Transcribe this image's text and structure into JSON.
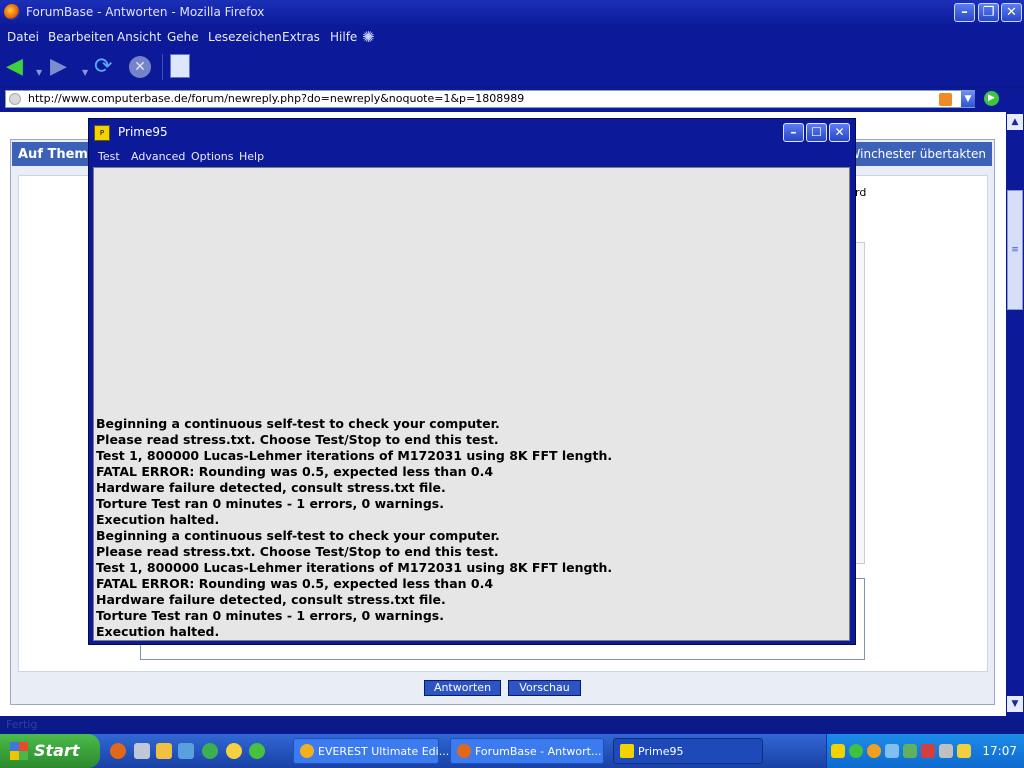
{
  "firefox": {
    "title": "ForumBase - Antworten - Mozilla Firefox",
    "menu": [
      "Datei",
      "Bearbeiten",
      "Ansicht",
      "Gehe",
      "Lesezeichen",
      "Extras",
      "Hilfe"
    ],
    "url": "http://www.computerbase.de/forum/newreply.php?do=newreply&noquote=1&p=1808989",
    "status": "Fertig"
  },
  "page": {
    "thread_left": "Auf Them",
    "thread_right": "Winchester übertakten",
    "side_fragment": "rd",
    "answer_button": "Antworten",
    "preview_button": "Vorschau"
  },
  "prime95": {
    "title": "Prime95",
    "menu": [
      "Test",
      "Advanced",
      "Options",
      "Help"
    ],
    "log": [
      "Beginning a continuous self-test to check your computer.",
      "Please read stress.txt.  Choose Test/Stop to end this test.",
      "Test 1, 800000 Lucas-Lehmer iterations of M172031 using 8K FFT length.",
      "FATAL ERROR: Rounding was 0.5, expected less than 0.4",
      "Hardware failure detected, consult stress.txt file.",
      "Torture Test ran 0 minutes - 1 errors, 0 warnings.",
      "Execution halted.",
      "Beginning a continuous self-test to check your computer.",
      "Please read stress.txt.  Choose Test/Stop to end this test.",
      "Test 1, 800000 Lucas-Lehmer iterations of M172031 using 8K FFT length.",
      "FATAL ERROR: Rounding was 0.5, expected less than 0.4",
      "Hardware failure detected, consult stress.txt file.",
      "Torture Test ran 0 minutes - 1 errors, 0 warnings.",
      "Execution halted."
    ]
  },
  "taskbar": {
    "start": "Start",
    "tasks": [
      "EVEREST Ultimate Edi...",
      "ForumBase - Antwort...",
      "Prime95"
    ],
    "clock": "17:07"
  }
}
